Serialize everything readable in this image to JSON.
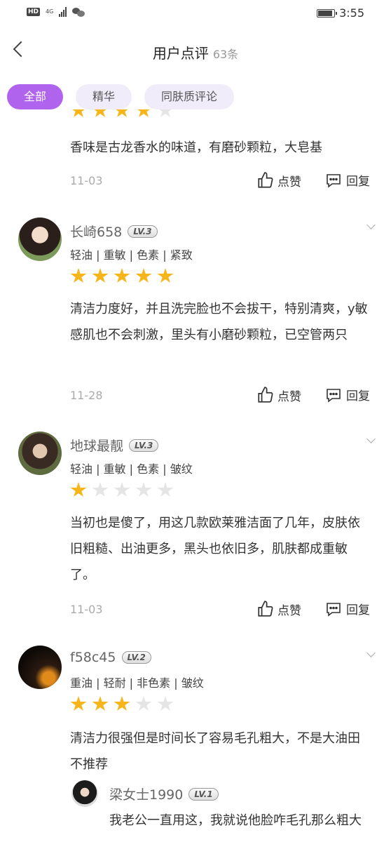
{
  "status_bar": {
    "hd": "HD",
    "network": "4G",
    "time": "3:55"
  },
  "header": {
    "title": "用户点评",
    "count": "63条"
  },
  "filters": [
    {
      "label": "全部",
      "active": true
    },
    {
      "label": "精华",
      "active": false
    },
    {
      "label": "同肤质评论",
      "active": false
    }
  ],
  "first_review": {
    "rating": 4,
    "text": "香味是古龙香水的味道，有磨砂颗粒，大皂基",
    "date": "11-03"
  },
  "reviews": [
    {
      "username": "长崎658",
      "level": "LV.3",
      "tags": "轻油 | 重敏 | 色素 | 紧致",
      "rating": 5,
      "text": "清洁力度好，并且洗完脸也不会拔干，特别清爽，y敏感肌也不会刺激，里头有小磨砂颗粒，已空管两只",
      "date": "11-28"
    },
    {
      "username": "地球最靓",
      "level": "LV.3",
      "tags": "轻油 | 重敏 | 色素 | 皱纹",
      "rating": 1,
      "text": "当初也是傻了，用这几款欧莱雅洁面了几年，皮肤依旧粗糙、出油更多，黑头也依旧多，肌肤都成重敏了。",
      "date": "11-03"
    },
    {
      "username": "f58c45",
      "level": "LV.2",
      "tags": "重油 | 轻耐 | 非色素 | 皱纹",
      "rating": 3,
      "text": "清洁力很强但是时间长了容易毛孔粗大，不是大油田不推荐"
    }
  ],
  "actions": {
    "like": "点赞",
    "reply": "回复"
  },
  "sub_reply": {
    "username": "梁女士1990",
    "level": "LV.1",
    "text": "我老公一直用这，我就说他脸咋毛孔那么粗大"
  }
}
